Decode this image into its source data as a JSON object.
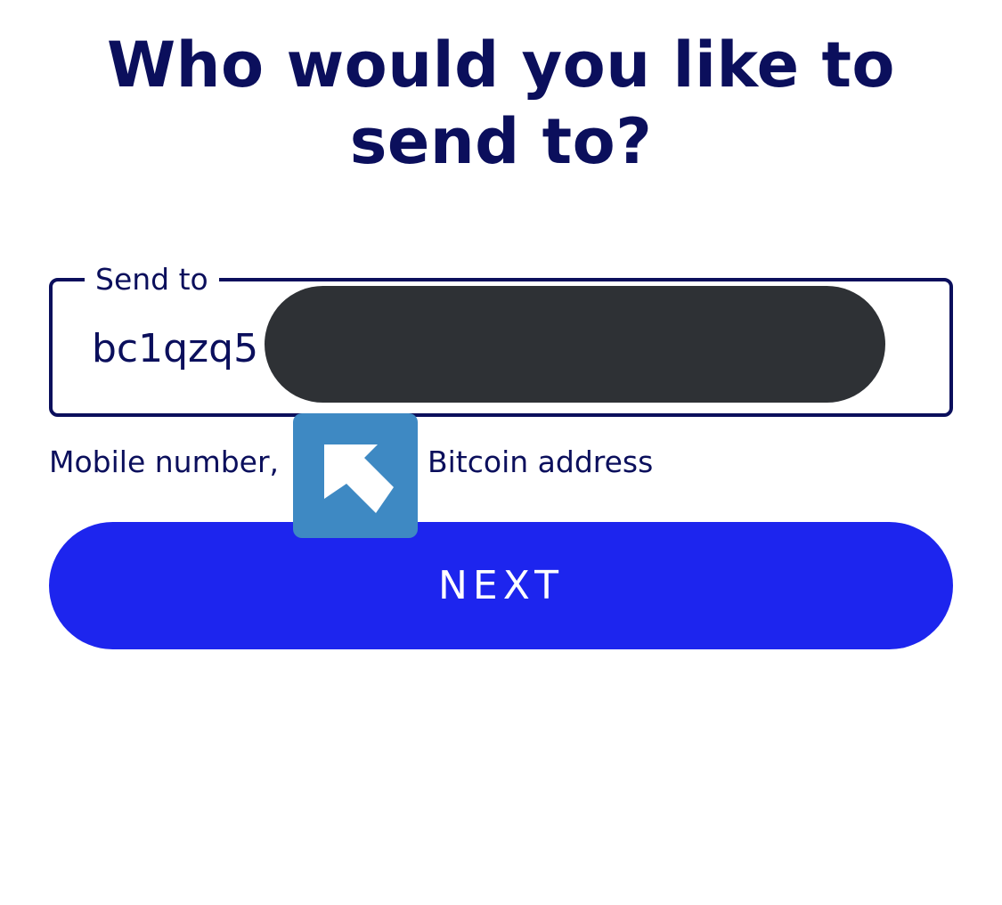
{
  "heading": {
    "line1": "Who would you like to",
    "line2": "send to?"
  },
  "send_field": {
    "label": "Send to",
    "value": "bc1qzq5"
  },
  "helper": {
    "left_text": "Mobile number,",
    "right_text": "Bitcoin address"
  },
  "next_button": {
    "label": "NEXT"
  },
  "colors": {
    "text": "#0b0f5c",
    "button": "#1d25ee",
    "redaction": "#2e3135",
    "cursor_tile": "#3e89c3"
  },
  "icons": {
    "cursor": "arrow-up-left-icon"
  }
}
